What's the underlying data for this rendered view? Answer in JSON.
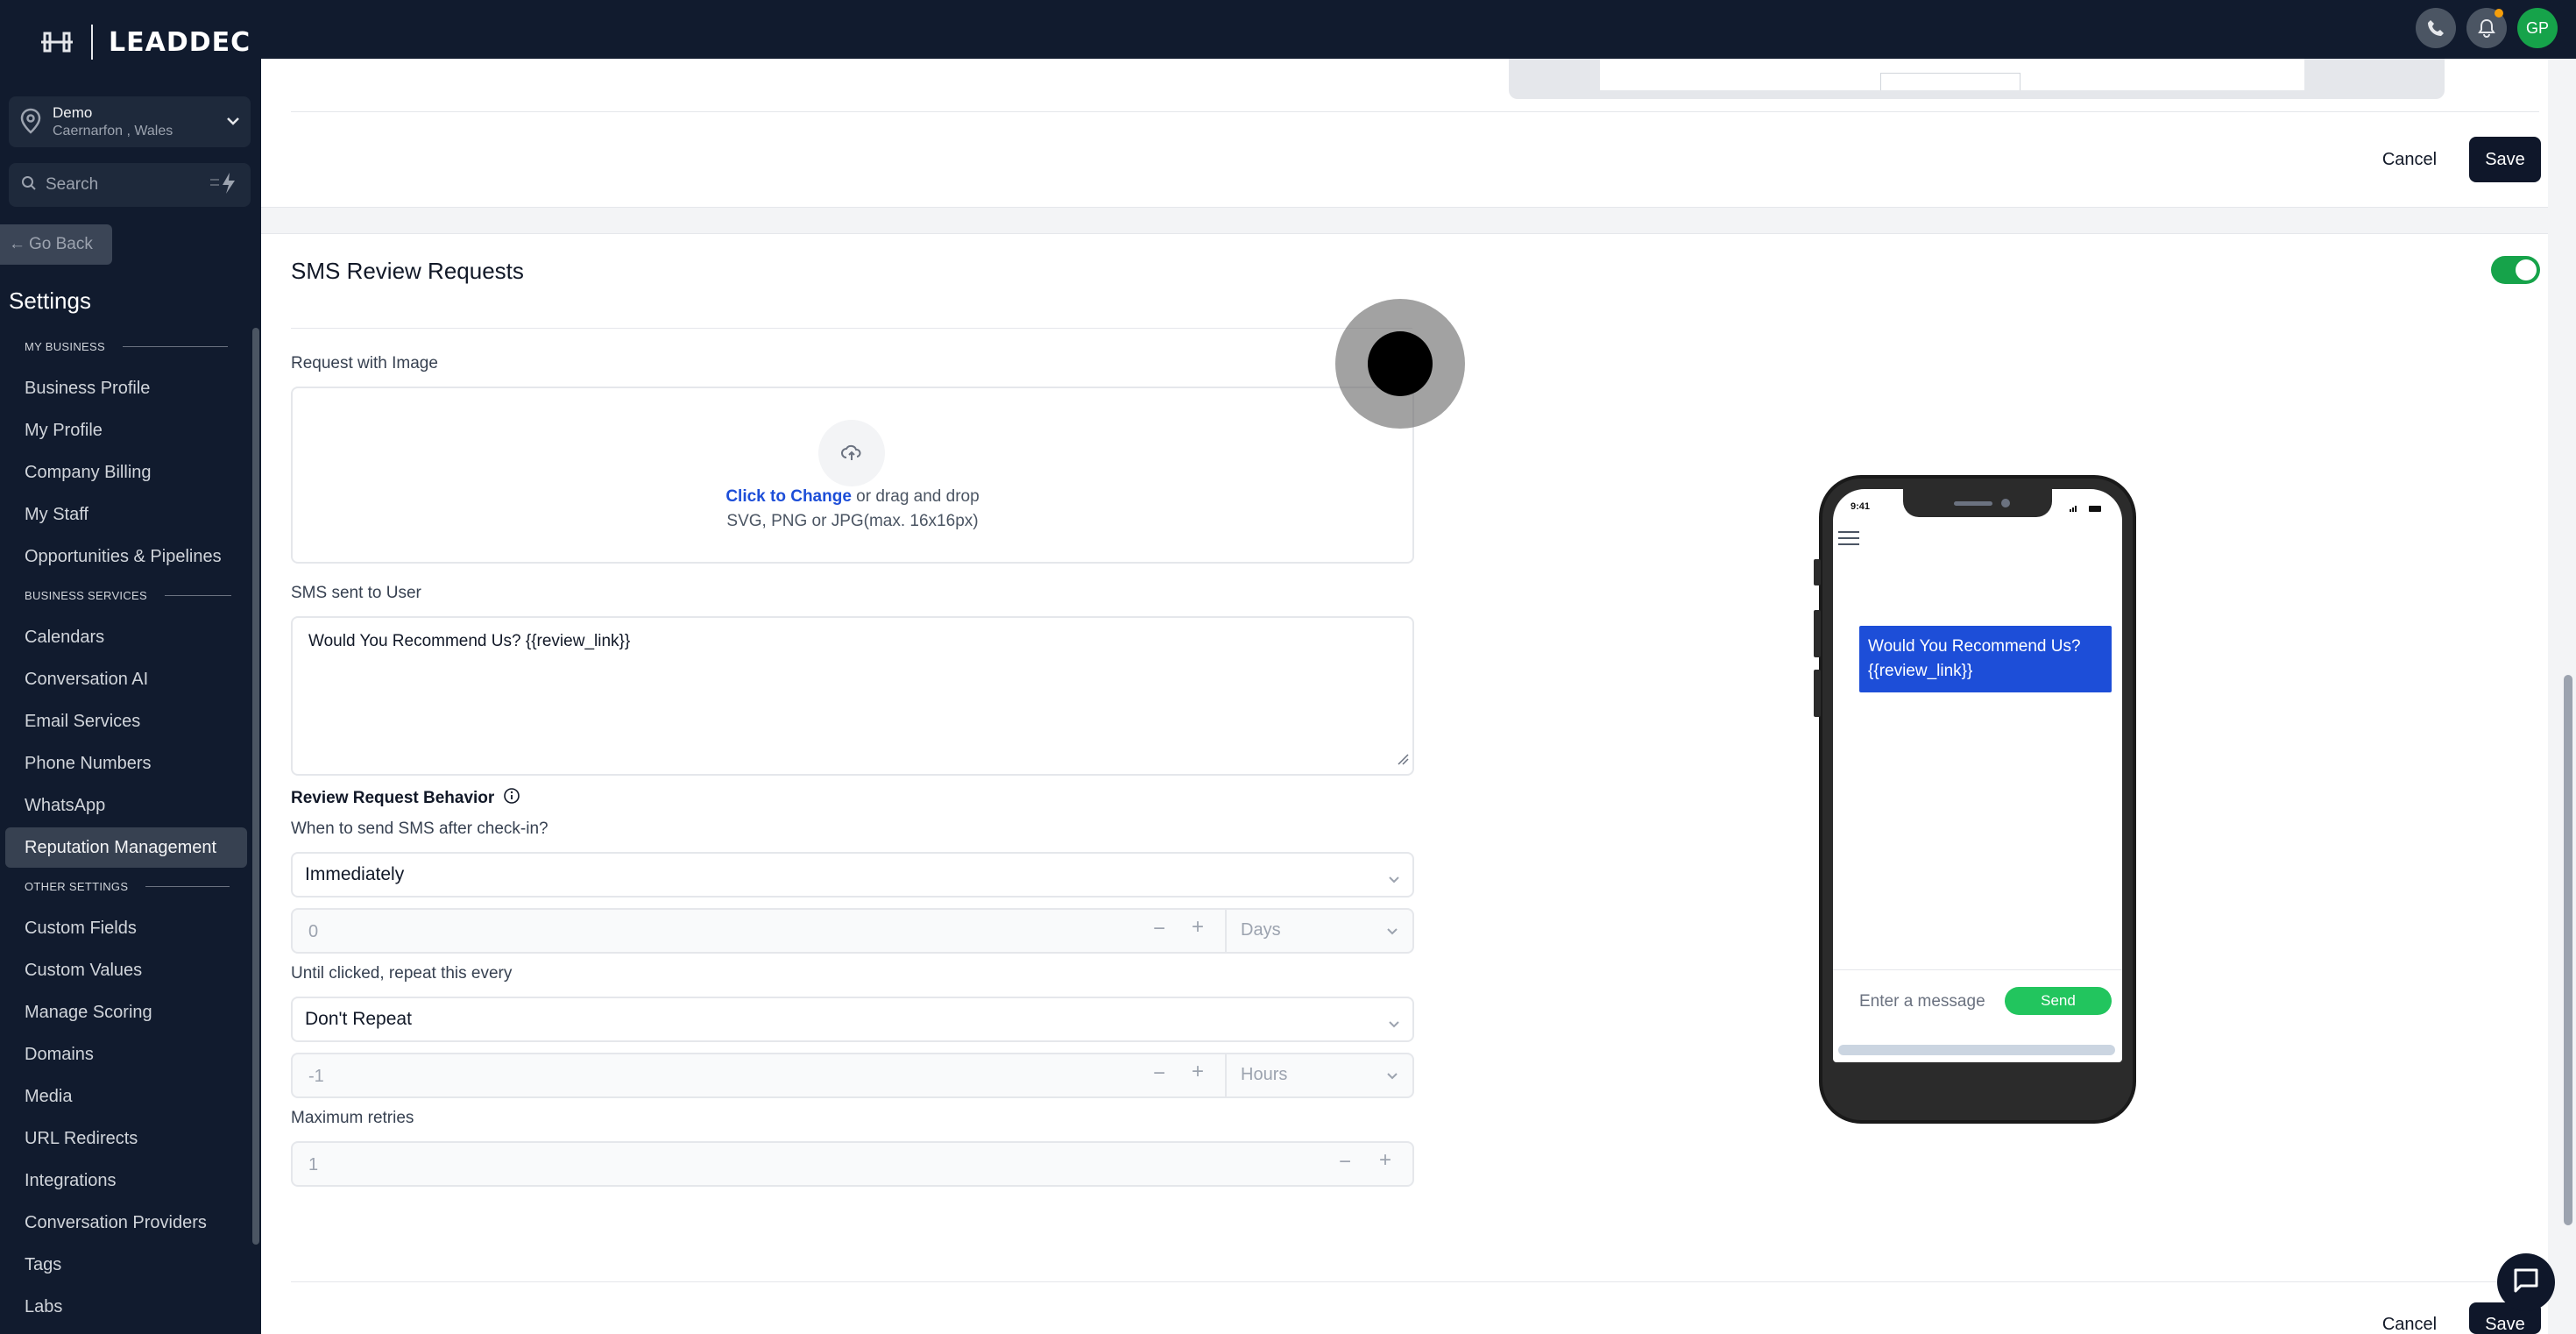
{
  "brand": {
    "name": "LEADDEC"
  },
  "location": {
    "name": "Demo",
    "address": "Caernarfon , Wales"
  },
  "search": {
    "placeholder": "Search"
  },
  "nav": {
    "go_back": "Go Back",
    "title": "Settings",
    "sections": [
      {
        "label": "MY BUSINESS",
        "items": [
          "Business Profile",
          "My Profile",
          "Company Billing",
          "My Staff",
          "Opportunities & Pipelines"
        ]
      },
      {
        "label": "BUSINESS SERVICES",
        "items": [
          "Calendars",
          "Conversation AI",
          "Email Services",
          "Phone Numbers",
          "WhatsApp",
          "Reputation Management"
        ]
      },
      {
        "label": "OTHER SETTINGS",
        "items": [
          "Custom Fields",
          "Custom Values",
          "Manage Scoring",
          "Domains",
          "Media",
          "URL Redirects",
          "Integrations",
          "Conversation Providers",
          "Tags",
          "Labs"
        ]
      }
    ],
    "active_item": "Reputation Management"
  },
  "topbar": {
    "avatar_initials": "GP"
  },
  "actions": {
    "cancel": "Cancel",
    "save": "Save"
  },
  "sms": {
    "title": "SMS Review Requests",
    "enabled": true,
    "image_label": "Request with Image",
    "upload_link": "Click to Change",
    "upload_rest": " or drag and drop",
    "upload_hint": "SVG, PNG or JPG(max. 16x16px)",
    "message_label": "SMS sent to User",
    "message_value": "Would You Recommend Us? {{review_link}}",
    "behavior_label": "Review Request Behavior",
    "when_label": "When to send SMS after check-in?",
    "when_value": "Immediately",
    "delay_value": "0",
    "delay_unit": "Days",
    "repeat_label": "Until clicked, repeat this every",
    "repeat_value": "Don't Repeat",
    "repeat_num": "-1",
    "repeat_unit": "Hours",
    "retries_label": "Maximum retries",
    "retries_value": "1"
  },
  "phone": {
    "time": "9:41",
    "bubble_line1": "Would You Recommend Us?",
    "bubble_line2": "{{review_link}}",
    "composer_placeholder": "Enter a message",
    "send_label": "Send"
  },
  "colors": {
    "accent": "#16a34a",
    "sidebar": "#111b2e",
    "link": "#1d4ed8",
    "save_button": "#0f172a"
  }
}
